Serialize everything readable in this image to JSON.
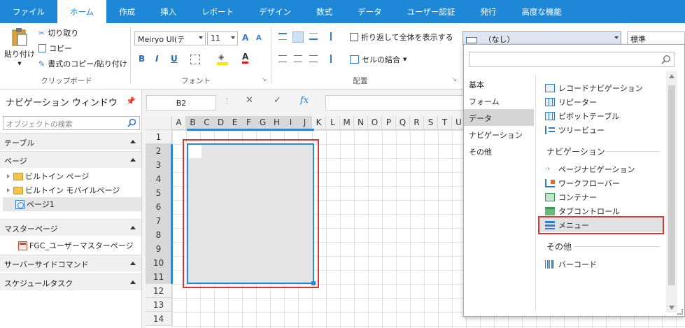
{
  "colors": {
    "ribbon_blue": "#1e87d6",
    "selection_blue": "#2b8ad8",
    "highlight_red": "#e03434"
  },
  "tabs": [
    {
      "label": "ファイル"
    },
    {
      "label": "ホーム"
    },
    {
      "label": "作成"
    },
    {
      "label": "挿入"
    },
    {
      "label": "レポート"
    },
    {
      "label": "デザイン"
    },
    {
      "label": "数式"
    },
    {
      "label": "データ"
    },
    {
      "label": "ユーザー認証"
    },
    {
      "label": "発行"
    },
    {
      "label": "高度な機能"
    }
  ],
  "ribbon": {
    "clipboard": {
      "paste": "貼り付け",
      "cut": "切り取り",
      "copy": "コピー",
      "format_copy": "書式のコピー/貼り付け",
      "label": "クリップボード"
    },
    "font": {
      "family": "Meiryo UI(テ",
      "size": "11",
      "grow": "A",
      "shrink": "A",
      "bold": "B",
      "italic": "I",
      "underline": "U",
      "font_color": "A",
      "label": "フォント"
    },
    "alignment": {
      "wrap": "折り返して全体を表示する",
      "merge": "セルの結合",
      "label": "配置"
    },
    "style_combo": "（なし）",
    "number_combo": "標準"
  },
  "nav": {
    "title": "ナビゲーション ウィンドウ",
    "search_placeholder": "オブジェクトの検索",
    "sections": {
      "table": "テーブル",
      "page": "ページ",
      "master": "マスターページ",
      "server": "サーバーサイドコマンド",
      "schedule": "スケジュールタスク"
    },
    "items": {
      "builtin_page": "ビルトイン ページ",
      "builtin_mobile": "ビルトイン モバイルページ",
      "page1": "ページ1",
      "master1": "FGC_ユーザーマスターページ"
    }
  },
  "formula_bar": {
    "cell_name": "B2",
    "cancel": "✕",
    "confirm": "✓",
    "fx": "fx"
  },
  "grid": {
    "columns": [
      "A",
      "B",
      "C",
      "D",
      "E",
      "F",
      "G",
      "H",
      "I",
      "J",
      "K",
      "L",
      "M",
      "N",
      "O",
      "P",
      "Q",
      "R",
      "S",
      "T",
      "U"
    ],
    "rows": [
      "1",
      "2",
      "3",
      "4",
      "5",
      "6",
      "7",
      "8",
      "9",
      "10",
      "11",
      "12",
      "13",
      "14"
    ],
    "far_column": "A"
  },
  "dropdown": {
    "categories": [
      "基本",
      "フォーム",
      "データ",
      "ナビゲーション",
      "その他"
    ],
    "data_items": [
      "レコードナビゲーション",
      "リピーター",
      "ピボットテーブル",
      "ツリービュー"
    ],
    "nav_heading": "ナビゲーション",
    "nav_items": [
      "ページナビゲーション",
      "ワークフローバー",
      "コンテナー",
      "タブコントロール",
      "メニュー"
    ],
    "other_heading": "その他",
    "other_items": [
      "バーコード"
    ]
  }
}
